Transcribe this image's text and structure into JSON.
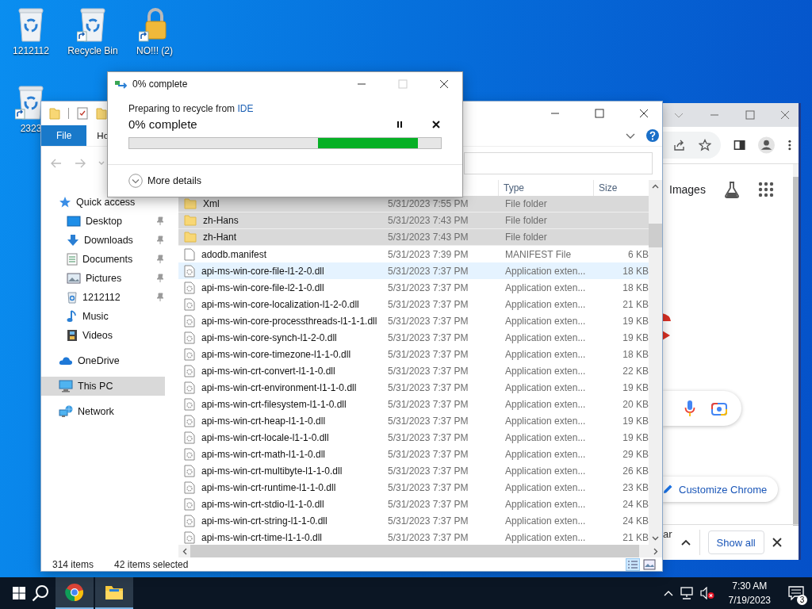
{
  "desktop_icons": [
    {
      "label": "1212112",
      "kind": "recycle",
      "shortcut": false
    },
    {
      "label": "Recycle Bin",
      "kind": "recycle",
      "shortcut": true
    },
    {
      "label": "NO!!! (2)",
      "kind": "lock",
      "shortcut": true
    },
    {
      "label": "2323",
      "kind": "recycle",
      "shortcut": true
    }
  ],
  "progress_dialog": {
    "title": "0% complete",
    "status_prefix": "Preparing to recycle from",
    "source_link": "IDE",
    "heading": "0% complete",
    "details_label": "More details"
  },
  "explorer": {
    "ribbon_tabs": [
      {
        "label": "File",
        "selected": true
      },
      {
        "label": "Ho",
        "selected": false
      }
    ],
    "nav_pane": [
      {
        "label": "Quick access",
        "kind": "quick",
        "selected": false,
        "children": [
          {
            "label": "Desktop",
            "kind": "desktop",
            "pinned": true,
            "selected": false
          },
          {
            "label": "Downloads",
            "kind": "downloads",
            "pinned": true,
            "selected": false
          },
          {
            "label": "Documents",
            "kind": "documents",
            "pinned": true,
            "selected": false
          },
          {
            "label": "Pictures",
            "kind": "pictures",
            "pinned": true,
            "selected": false
          },
          {
            "label": "1212112",
            "kind": "recycle",
            "pinned": true,
            "selected": false
          },
          {
            "label": "Music",
            "kind": "music",
            "pinned": false,
            "selected": false
          },
          {
            "label": "Videos",
            "kind": "videos",
            "pinned": false,
            "selected": false
          }
        ]
      },
      {
        "label": "OneDrive",
        "kind": "onedrive",
        "selected": false
      },
      {
        "label": "This PC",
        "kind": "pc",
        "selected": true
      },
      {
        "label": "Network",
        "kind": "network",
        "selected": false
      }
    ],
    "columns": [
      "Type",
      "Size"
    ],
    "rows": [
      {
        "name": "Xml",
        "modified": "5/31/2023 7:55 PM",
        "type": "File folder",
        "kind": "folder",
        "selected": true,
        "hovered": false
      },
      {
        "name": "zh-Hans",
        "modified": "5/31/2023 7:43 PM",
        "type": "File folder",
        "kind": "folder",
        "selected": true,
        "hovered": false
      },
      {
        "name": "zh-Hant",
        "modified": "5/31/2023 7:43 PM",
        "type": "File folder",
        "kind": "folder",
        "selected": true,
        "hovered": false
      },
      {
        "name": "adodb.manifest",
        "modified": "5/31/2023 7:39 PM",
        "type": "MANIFEST File",
        "size": "6 KB",
        "kind": "file",
        "selected": false,
        "hovered": false
      },
      {
        "name": "api-ms-win-core-file-l1-2-0.dll",
        "modified": "5/31/2023 7:37 PM",
        "type": "Application exten...",
        "size": "18 KB",
        "kind": "dll",
        "selected": false,
        "hovered": true
      },
      {
        "name": "api-ms-win-core-file-l2-1-0.dll",
        "modified": "5/31/2023 7:37 PM",
        "type": "Application exten...",
        "size": "18 KB",
        "kind": "dll",
        "selected": false,
        "hovered": false
      },
      {
        "name": "api-ms-win-core-localization-l1-2-0.dll",
        "modified": "5/31/2023 7:37 PM",
        "type": "Application exten...",
        "size": "21 KB",
        "kind": "dll",
        "selected": false,
        "hovered": false
      },
      {
        "name": "api-ms-win-core-processthreads-l1-1-1.dll",
        "modified": "5/31/2023 7:37 PM",
        "type": "Application exten...",
        "size": "19 KB",
        "kind": "dll",
        "selected": false,
        "hovered": false
      },
      {
        "name": "api-ms-win-core-synch-l1-2-0.dll",
        "modified": "5/31/2023 7:37 PM",
        "type": "Application exten...",
        "size": "19 KB",
        "kind": "dll",
        "selected": false,
        "hovered": false
      },
      {
        "name": "api-ms-win-core-timezone-l1-1-0.dll",
        "modified": "5/31/2023 7:37 PM",
        "type": "Application exten...",
        "size": "18 KB",
        "kind": "dll",
        "selected": false,
        "hovered": false
      },
      {
        "name": "api-ms-win-crt-convert-l1-1-0.dll",
        "modified": "5/31/2023 7:37 PM",
        "type": "Application exten...",
        "size": "22 KB",
        "kind": "dll",
        "selected": false,
        "hovered": false
      },
      {
        "name": "api-ms-win-crt-environment-l1-1-0.dll",
        "modified": "5/31/2023 7:37 PM",
        "type": "Application exten...",
        "size": "19 KB",
        "kind": "dll",
        "selected": false,
        "hovered": false
      },
      {
        "name": "api-ms-win-crt-filesystem-l1-1-0.dll",
        "modified": "5/31/2023 7:37 PM",
        "type": "Application exten...",
        "size": "20 KB",
        "kind": "dll",
        "selected": false,
        "hovered": false
      },
      {
        "name": "api-ms-win-crt-heap-l1-1-0.dll",
        "modified": "5/31/2023 7:37 PM",
        "type": "Application exten...",
        "size": "19 KB",
        "kind": "dll",
        "selected": false,
        "hovered": false
      },
      {
        "name": "api-ms-win-crt-locale-l1-1-0.dll",
        "modified": "5/31/2023 7:37 PM",
        "type": "Application exten...",
        "size": "19 KB",
        "kind": "dll",
        "selected": false,
        "hovered": false
      },
      {
        "name": "api-ms-win-crt-math-l1-1-0.dll",
        "modified": "5/31/2023 7:37 PM",
        "type": "Application exten...",
        "size": "29 KB",
        "kind": "dll",
        "selected": false,
        "hovered": false
      },
      {
        "name": "api-ms-win-crt-multibyte-l1-1-0.dll",
        "modified": "5/31/2023 7:37 PM",
        "type": "Application exten...",
        "size": "26 KB",
        "kind": "dll",
        "selected": false,
        "hovered": false
      },
      {
        "name": "api-ms-win-crt-runtime-l1-1-0.dll",
        "modified": "5/31/2023 7:37 PM",
        "type": "Application exten...",
        "size": "23 KB",
        "kind": "dll",
        "selected": false,
        "hovered": false
      },
      {
        "name": "api-ms-win-crt-stdio-l1-1-0.dll",
        "modified": "5/31/2023 7:37 PM",
        "type": "Application exten...",
        "size": "24 KB",
        "kind": "dll",
        "selected": false,
        "hovered": false
      },
      {
        "name": "api-ms-win-crt-string-l1-1-0.dll",
        "modified": "5/31/2023 7:37 PM",
        "type": "Application exten...",
        "size": "24 KB",
        "kind": "dll",
        "selected": false,
        "hovered": false
      },
      {
        "name": "api-ms-win-crt-time-l1-1-0.dll",
        "modified": "5/31/2023 7:37 PM",
        "type": "Application exten...",
        "size": "21 KB",
        "kind": "dll",
        "selected": false,
        "hovered": false
      }
    ],
    "status_bar": {
      "item_count": "314 items",
      "selection": "42 items selected"
    }
  },
  "browser": {
    "images_link": "Images",
    "customize_button": "Customize Chrome",
    "download_item": "ar",
    "show_all": "Show all"
  },
  "taskbar": {
    "apps": [
      {
        "kind": "chrome"
      },
      {
        "kind": "explorer"
      }
    ],
    "time": "7:30 AM",
    "date": "7/19/2023",
    "notification_count": "3"
  }
}
